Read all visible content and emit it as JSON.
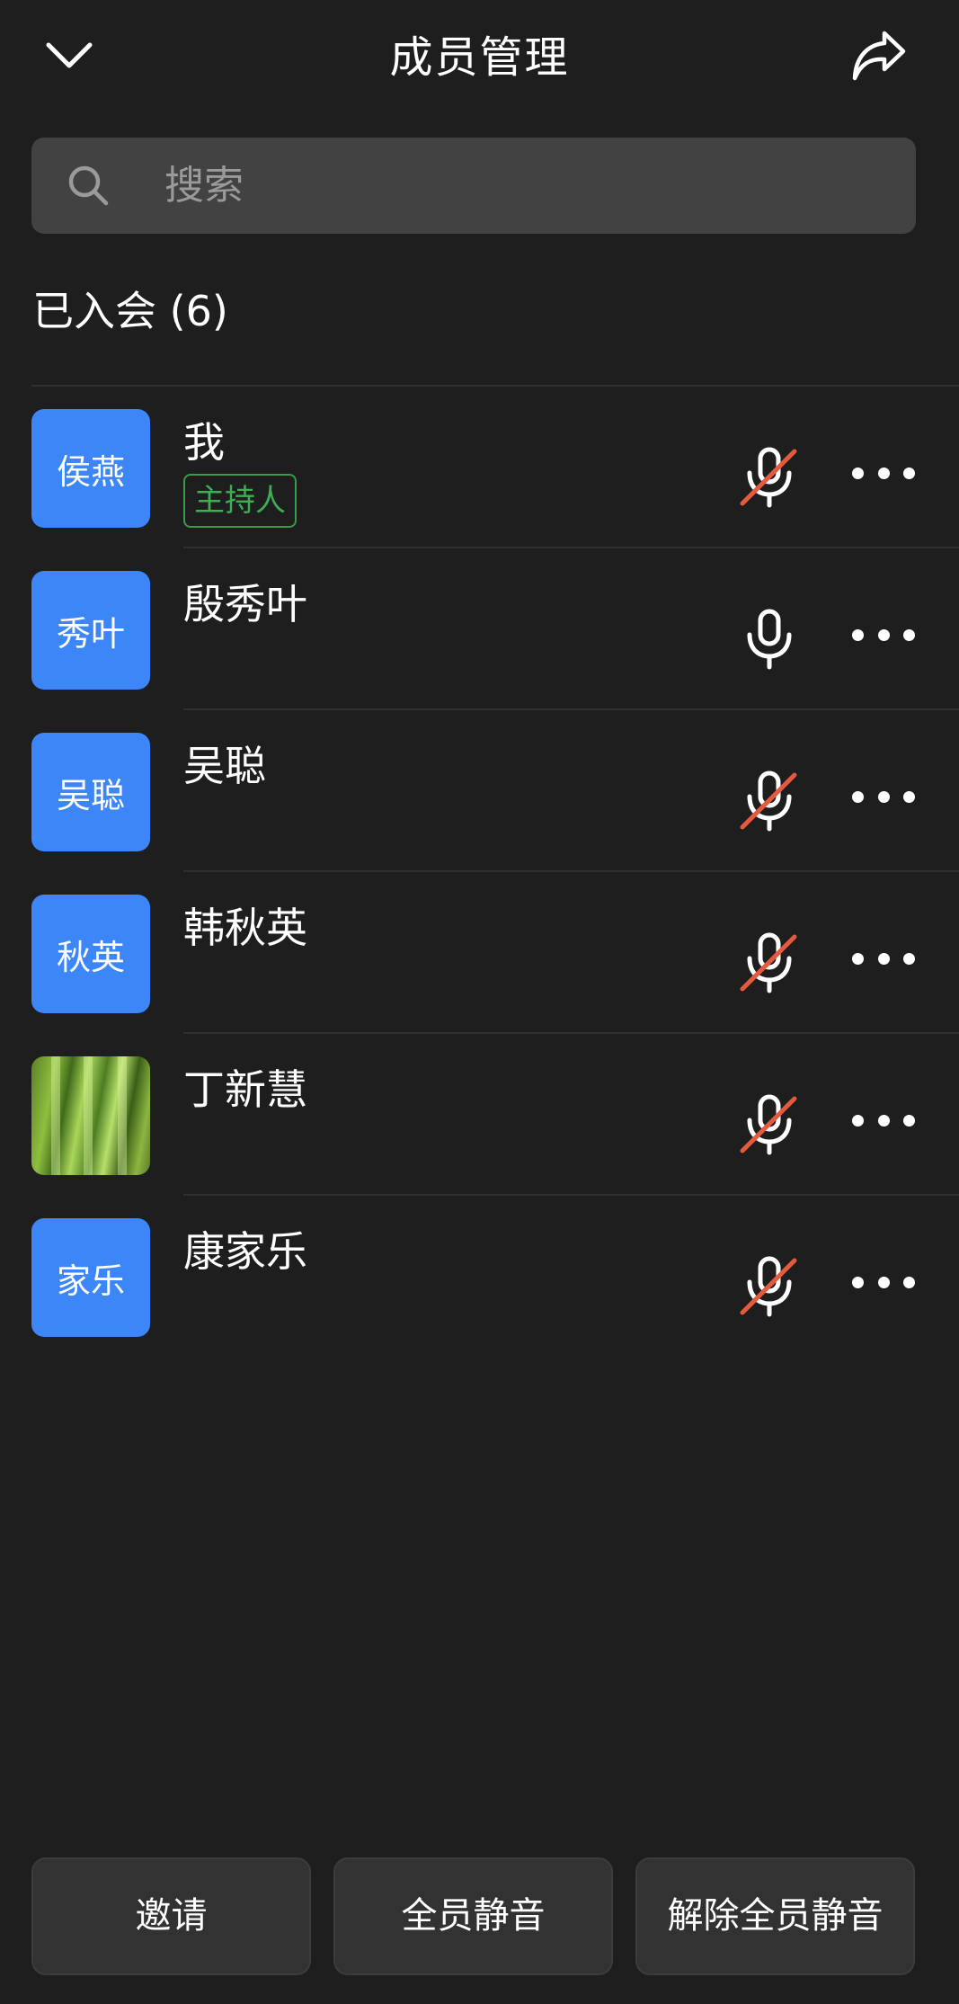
{
  "header": {
    "title": "成员管理",
    "back_icon": "chevron-down-icon",
    "share_icon": "share-arrow-icon"
  },
  "search": {
    "placeholder": "搜索",
    "icon": "search-icon"
  },
  "section": {
    "label": "已入会 (6)"
  },
  "members": [
    {
      "avatar_text": "侯燕",
      "name": "我",
      "badge": "主持人",
      "mic": "muted",
      "avatar_type": "initials"
    },
    {
      "avatar_text": "秀叶",
      "name": "殷秀叶",
      "badge": "",
      "mic": "on",
      "avatar_type": "initials"
    },
    {
      "avatar_text": "吴聪",
      "name": "吴聪",
      "badge": "",
      "mic": "muted",
      "avatar_type": "initials"
    },
    {
      "avatar_text": "秋英",
      "name": "韩秋英",
      "badge": "",
      "mic": "muted",
      "avatar_type": "initials"
    },
    {
      "avatar_text": "",
      "name": "丁新慧",
      "badge": "",
      "mic": "muted",
      "avatar_type": "photo"
    },
    {
      "avatar_text": "家乐",
      "name": "康家乐",
      "badge": "",
      "mic": "muted",
      "avatar_type": "initials"
    }
  ],
  "buttons": {
    "invite": "邀请",
    "mute_all": "全员静音",
    "unmute_all": "解除全员静音"
  },
  "colors": {
    "background": "#1e1e1e",
    "avatar": "#3d86f7",
    "host_badge": "#3fae53",
    "muted_slash": "#e55a3c"
  }
}
